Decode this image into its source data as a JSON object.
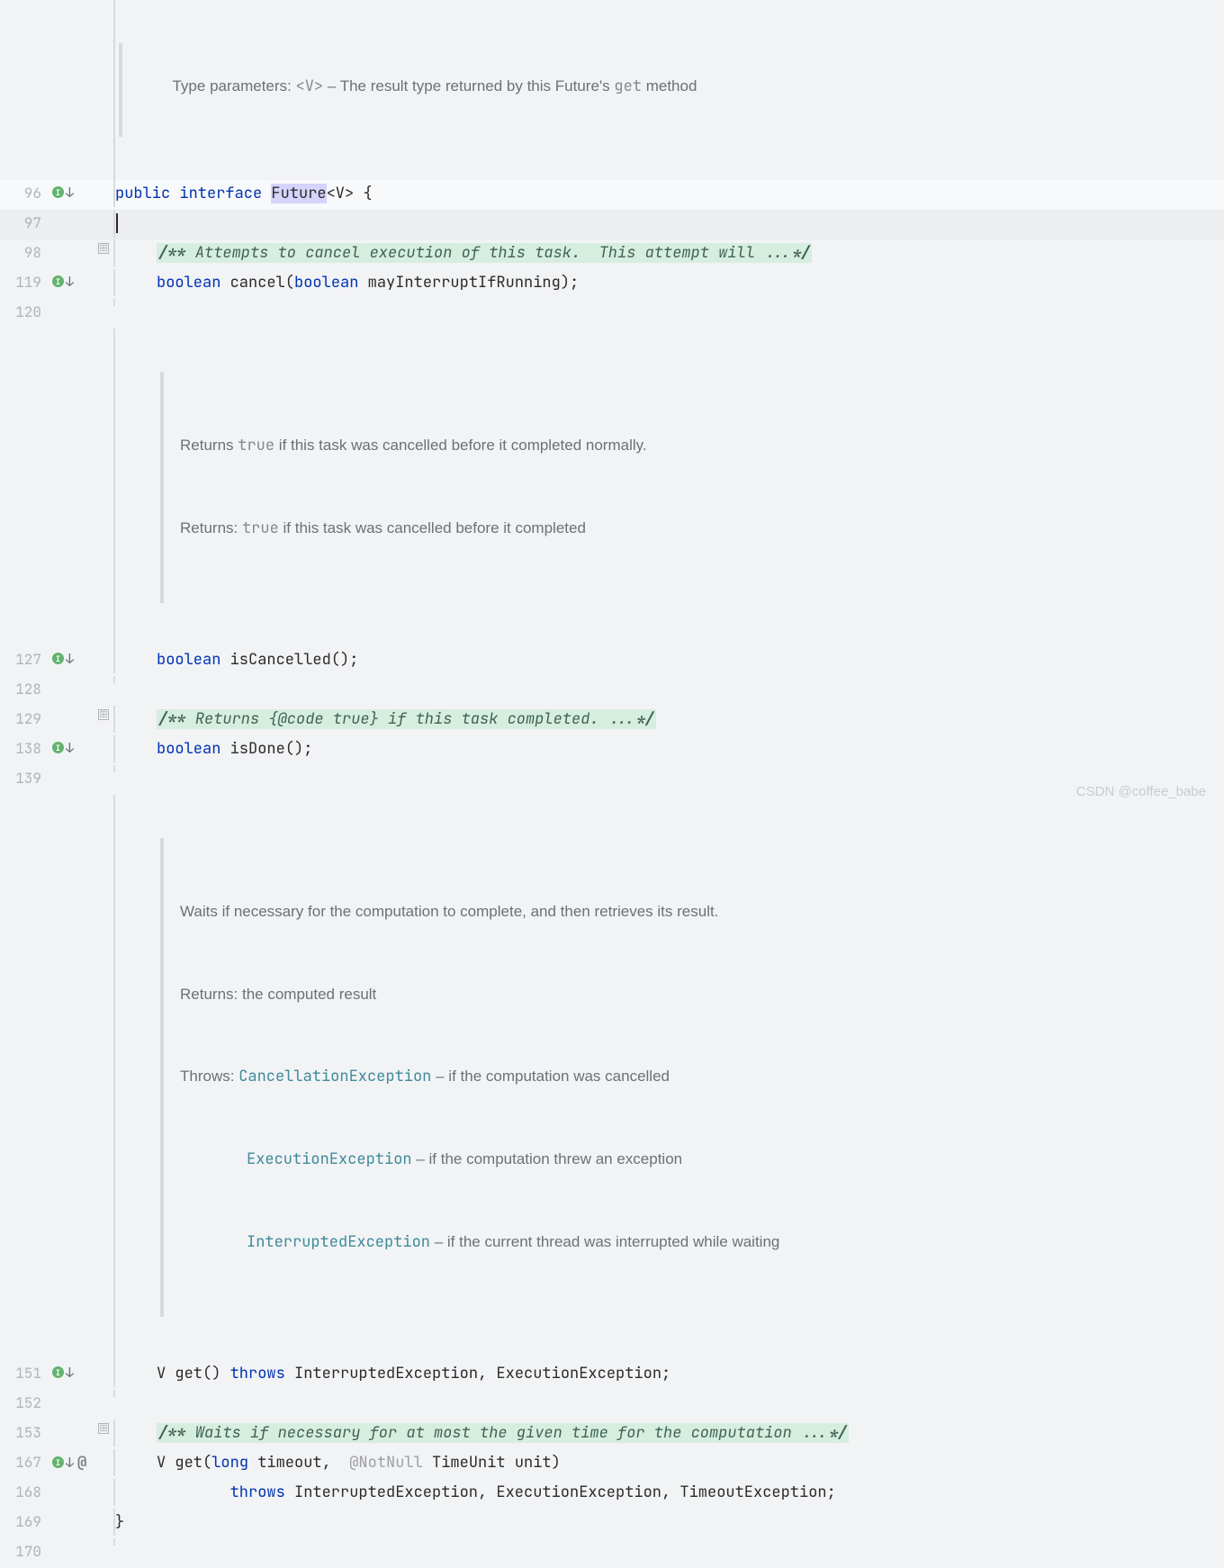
{
  "watermark": "CSDN @coffee_babe",
  "doc_top": {
    "label": "Type parameters: ",
    "param": "<V>",
    "dash": " – ",
    "text1": "The result type returned by this Future's ",
    "mono": "get",
    "text2": " method"
  },
  "gutter": {
    "l96": "96",
    "l97": "97",
    "l98": "98",
    "l119": "119",
    "l120": "120",
    "l127": "127",
    "l128": "128",
    "l129": "129",
    "l138": "138",
    "l139": "139",
    "l151": "151",
    "l152": "152",
    "l153": "153",
    "l167": "167",
    "l168": "168",
    "l169": "169",
    "l170": "170"
  },
  "code": {
    "public": "public ",
    "interface": "interface ",
    "future": "Future",
    "generic": "<V> {",
    "boolean": "boolean ",
    "cancel": "cancel(",
    "boolean2": "boolean ",
    "mayInterrupt": "mayInterruptIfRunning);",
    "isCancelled": "isCancelled();",
    "isDone": "isDone();",
    "V": "V ",
    "get": "get() ",
    "throws": "throws ",
    "getThrows": "InterruptedException, ExecutionException;",
    "get2": "get(",
    "long": "long ",
    "timeout": "timeout,  ",
    "notnull": "@NotNull",
    "timeunit": " TimeUnit unit)",
    "throws2line": "        throws ",
    "throws2list": "InterruptedException, ExecutionException, TimeoutException;",
    "close": "}"
  },
  "comments": {
    "c1a": "/** ",
    "c1b": "Attempts to cancel execution of this task.  This attempt will ...",
    "c1c": "*/",
    "c2a": "/** ",
    "c2b": "Returns {@code true} if this task completed. ...",
    "c2c": "*/",
    "c3a": "/** ",
    "c3b": "Waits if necessary for at most the given time for the computation ...",
    "c3c": "*/"
  },
  "doc1": {
    "l1a": "Returns ",
    "l1b": "true",
    "l1c": " if this task was cancelled before it completed normally.",
    "l2a": "Returns: ",
    "l2b": "true",
    "l2c": " if this task was cancelled before it completed"
  },
  "doc2": {
    "l1": "Waits if necessary for the computation to complete, and then retrieves its result.",
    "l2": "Returns: the computed result",
    "l3a": "Throws: ",
    "ex1": "CancellationException",
    "ex1t": " – if the computation was cancelled",
    "ex2": "ExecutionException",
    "ex2t": " – if the computation threw an exception",
    "ex3": "InterruptedException",
    "ex3t": " – if the current thread was interrupted while waiting"
  },
  "fold": {
    "plus": "⊞"
  },
  "atSign": "@"
}
